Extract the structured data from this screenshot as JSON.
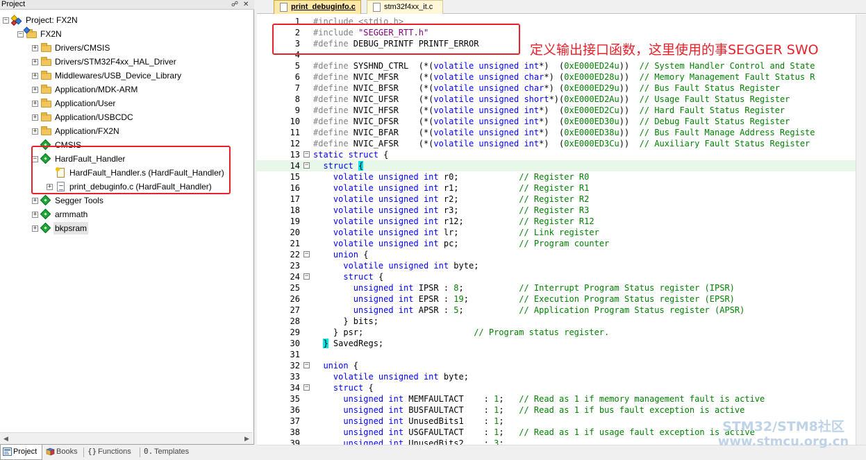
{
  "project_pane": {
    "title": "Project",
    "pin_icon": "pin-icon",
    "close_icon": "close-icon",
    "tree": [
      {
        "label": "Project: FX2N",
        "level": 0,
        "icon": "project-icon",
        "toggle": "−"
      },
      {
        "label": "FX2N",
        "level": 1,
        "icon": "target-folder-icon",
        "toggle": "−"
      },
      {
        "label": "Drivers/CMSIS",
        "level": 2,
        "icon": "folder-icon",
        "toggle": "+"
      },
      {
        "label": "Drivers/STM32F4xx_HAL_Driver",
        "level": 2,
        "icon": "folder-icon",
        "toggle": "+"
      },
      {
        "label": "Middlewares/USB_Device_Library",
        "level": 2,
        "icon": "folder-icon",
        "toggle": "+"
      },
      {
        "label": "Application/MDK-ARM",
        "level": 2,
        "icon": "folder-icon",
        "toggle": "+"
      },
      {
        "label": "Application/User",
        "level": 2,
        "icon": "folder-icon",
        "toggle": "+"
      },
      {
        "label": "Application/USBCDC",
        "level": 2,
        "icon": "folder-icon",
        "toggle": "+"
      },
      {
        "label": "Application/FX2N",
        "level": 2,
        "icon": "folder-icon",
        "toggle": "+"
      },
      {
        "label": "CMSIS",
        "level": 2,
        "icon": "diamond-icon",
        "toggle": ""
      },
      {
        "label": "HardFault_Handler",
        "level": 2,
        "icon": "diamond-icon",
        "toggle": "−"
      },
      {
        "label": "HardFault_Handler.s (HardFault_Handler)",
        "level": 3,
        "icon": "asm-file-icon",
        "toggle": ""
      },
      {
        "label": "print_debuginfo.c (HardFault_Handler)",
        "level": 3,
        "icon": "c-file-icon",
        "toggle": "+"
      },
      {
        "label": "Segger Tools",
        "level": 2,
        "icon": "diamond-icon",
        "toggle": "+"
      },
      {
        "label": "armmath",
        "level": 2,
        "icon": "diamond-icon",
        "toggle": "+"
      },
      {
        "label": "bkpsram",
        "level": 2,
        "icon": "diamond-icon",
        "toggle": "+",
        "selected": true
      }
    ],
    "bottom_tabs": [
      {
        "label": "Project",
        "icon": "project-tab-icon",
        "active": true
      },
      {
        "label": "Books",
        "icon": "books-icon",
        "active": false
      },
      {
        "label": "Functions",
        "icon": "functions-icon",
        "active": false
      },
      {
        "label": "Templates",
        "icon": "templates-icon",
        "active": false
      }
    ]
  },
  "editor": {
    "tabs": [
      {
        "label": "print_debuginfo.c",
        "active": true
      },
      {
        "label": "stm32f4xx_it.c",
        "active": false
      }
    ],
    "highlight_line": 14,
    "lines": [
      {
        "n": "1",
        "fold": "",
        "spans": [
          [
            "pp",
            "#include <stdio.h>"
          ]
        ]
      },
      {
        "n": "2",
        "fold": "",
        "spans": [
          [
            "pp",
            "#include "
          ],
          [
            "st",
            "\"SEGGER_RTT.h\""
          ]
        ]
      },
      {
        "n": "3",
        "fold": "",
        "spans": [
          [
            "pp",
            "#define"
          ],
          [
            "",
            " DEBUG_PRINTF PRINTF_ERROR"
          ]
        ]
      },
      {
        "n": "4",
        "fold": "",
        "spans": []
      },
      {
        "n": "5",
        "fold": "",
        "spans": [
          [
            "pp",
            "#define"
          ],
          [
            "",
            " SYSHND_CTRL  (*("
          ],
          [
            "kw",
            "volatile unsigned int"
          ],
          [
            "",
            "*)  ("
          ],
          [
            "nm",
            "0xE000ED24u"
          ],
          [
            "",
            "))  "
          ],
          [
            "cm",
            "// System Handler Control and State"
          ]
        ]
      },
      {
        "n": "6",
        "fold": "",
        "spans": [
          [
            "pp",
            "#define"
          ],
          [
            "",
            " NVIC_MFSR    (*("
          ],
          [
            "kw",
            "volatile unsigned char"
          ],
          [
            "",
            "*) ("
          ],
          [
            "nm",
            "0xE000ED28u"
          ],
          [
            "",
            "))  "
          ],
          [
            "cm",
            "// Memory Management Fault Status R"
          ]
        ]
      },
      {
        "n": "7",
        "fold": "",
        "spans": [
          [
            "pp",
            "#define"
          ],
          [
            "",
            " NVIC_BFSR    (*("
          ],
          [
            "kw",
            "volatile unsigned char"
          ],
          [
            "",
            "*) ("
          ],
          [
            "nm",
            "0xE000ED29u"
          ],
          [
            "",
            "))  "
          ],
          [
            "cm",
            "// Bus Fault Status Register"
          ]
        ]
      },
      {
        "n": "8",
        "fold": "",
        "spans": [
          [
            "pp",
            "#define"
          ],
          [
            "",
            " NVIC_UFSR    (*("
          ],
          [
            "kw",
            "volatile unsigned short"
          ],
          [
            "",
            "*)("
          ],
          [
            "nm",
            "0xE000ED2Au"
          ],
          [
            "",
            "))  "
          ],
          [
            "cm",
            "// Usage Fault Status Register"
          ]
        ]
      },
      {
        "n": "9",
        "fold": "",
        "spans": [
          [
            "pp",
            "#define"
          ],
          [
            "",
            " NVIC_HFSR    (*("
          ],
          [
            "kw",
            "volatile unsigned int"
          ],
          [
            "",
            "*)  ("
          ],
          [
            "nm",
            "0xE000ED2Cu"
          ],
          [
            "",
            "))  "
          ],
          [
            "cm",
            "// Hard Fault Status Register"
          ]
        ]
      },
      {
        "n": "10",
        "fold": "",
        "spans": [
          [
            "pp",
            "#define"
          ],
          [
            "",
            " NVIC_DFSR    (*("
          ],
          [
            "kw",
            "volatile unsigned int"
          ],
          [
            "",
            "*)  ("
          ],
          [
            "nm",
            "0xE000ED30u"
          ],
          [
            "",
            "))  "
          ],
          [
            "cm",
            "// Debug Fault Status Register"
          ]
        ]
      },
      {
        "n": "11",
        "fold": "",
        "spans": [
          [
            "pp",
            "#define"
          ],
          [
            "",
            " NVIC_BFAR    (*("
          ],
          [
            "kw",
            "volatile unsigned int"
          ],
          [
            "",
            "*)  ("
          ],
          [
            "nm",
            "0xE000ED38u"
          ],
          [
            "",
            "))  "
          ],
          [
            "cm",
            "// Bus Fault Manage Address Registe"
          ]
        ]
      },
      {
        "n": "12",
        "fold": "",
        "spans": [
          [
            "pp",
            "#define"
          ],
          [
            "",
            " NVIC_AFSR    (*("
          ],
          [
            "kw",
            "volatile unsigned int"
          ],
          [
            "",
            "*)  ("
          ],
          [
            "nm",
            "0xE000ED3Cu"
          ],
          [
            "",
            "))  "
          ],
          [
            "cm",
            "// Auxiliary Fault Status Register"
          ]
        ]
      },
      {
        "n": "13",
        "fold": "−",
        "spans": [
          [
            "kw",
            "static struct"
          ],
          [
            "",
            " {"
          ]
        ]
      },
      {
        "n": "14",
        "fold": "−",
        "spans": [
          [
            "",
            "  "
          ],
          [
            "kw",
            "struct"
          ],
          [
            "",
            " "
          ],
          [
            "br",
            "{"
          ]
        ]
      },
      {
        "n": "15",
        "fold": "",
        "spans": [
          [
            "",
            "    "
          ],
          [
            "kw",
            "volatile unsigned int"
          ],
          [
            "",
            " r0;            "
          ],
          [
            "cm",
            "// Register R0"
          ]
        ]
      },
      {
        "n": "16",
        "fold": "",
        "spans": [
          [
            "",
            "    "
          ],
          [
            "kw",
            "volatile unsigned int"
          ],
          [
            "",
            " r1;            "
          ],
          [
            "cm",
            "// Register R1"
          ]
        ]
      },
      {
        "n": "17",
        "fold": "",
        "spans": [
          [
            "",
            "    "
          ],
          [
            "kw",
            "volatile unsigned int"
          ],
          [
            "",
            " r2;            "
          ],
          [
            "cm",
            "// Register R2"
          ]
        ]
      },
      {
        "n": "18",
        "fold": "",
        "spans": [
          [
            "",
            "    "
          ],
          [
            "kw",
            "volatile unsigned int"
          ],
          [
            "",
            " r3;            "
          ],
          [
            "cm",
            "// Register R3"
          ]
        ]
      },
      {
        "n": "19",
        "fold": "",
        "spans": [
          [
            "",
            "    "
          ],
          [
            "kw",
            "volatile unsigned int"
          ],
          [
            "",
            " r12;           "
          ],
          [
            "cm",
            "// Register R12"
          ]
        ]
      },
      {
        "n": "20",
        "fold": "",
        "spans": [
          [
            "",
            "    "
          ],
          [
            "kw",
            "volatile unsigned int"
          ],
          [
            "",
            " lr;            "
          ],
          [
            "cm",
            "// Link register"
          ]
        ]
      },
      {
        "n": "21",
        "fold": "",
        "spans": [
          [
            "",
            "    "
          ],
          [
            "kw",
            "volatile unsigned int"
          ],
          [
            "",
            " pc;            "
          ],
          [
            "cm",
            "// Program counter"
          ]
        ]
      },
      {
        "n": "22",
        "fold": "−",
        "spans": [
          [
            "",
            "    "
          ],
          [
            "kw",
            "union"
          ],
          [
            "",
            " {"
          ]
        ]
      },
      {
        "n": "23",
        "fold": "",
        "spans": [
          [
            "",
            "      "
          ],
          [
            "kw",
            "volatile unsigned int"
          ],
          [
            "",
            " byte;"
          ]
        ]
      },
      {
        "n": "24",
        "fold": "−",
        "spans": [
          [
            "",
            "      "
          ],
          [
            "kw",
            "struct"
          ],
          [
            "",
            " {"
          ]
        ]
      },
      {
        "n": "25",
        "fold": "",
        "spans": [
          [
            "",
            "        "
          ],
          [
            "kw",
            "unsigned int"
          ],
          [
            "",
            " IPSR : "
          ],
          [
            "nm",
            "8"
          ],
          [
            "",
            ";           "
          ],
          [
            "cm",
            "// Interrupt Program Status register (IPSR)"
          ]
        ]
      },
      {
        "n": "26",
        "fold": "",
        "spans": [
          [
            "",
            "        "
          ],
          [
            "kw",
            "unsigned int"
          ],
          [
            "",
            " EPSR : "
          ],
          [
            "nm",
            "19"
          ],
          [
            "",
            ";          "
          ],
          [
            "cm",
            "// Execution Program Status register (EPSR)"
          ]
        ]
      },
      {
        "n": "27",
        "fold": "",
        "spans": [
          [
            "",
            "        "
          ],
          [
            "kw",
            "unsigned int"
          ],
          [
            "",
            " APSR : "
          ],
          [
            "nm",
            "5"
          ],
          [
            "",
            ";           "
          ],
          [
            "cm",
            "// Application Program Status register (APSR)"
          ]
        ]
      },
      {
        "n": "28",
        "fold": "",
        "spans": [
          [
            "",
            "      } bits;"
          ]
        ]
      },
      {
        "n": "29",
        "fold": "",
        "spans": [
          [
            "",
            "    } psr;                      "
          ],
          [
            "cm",
            "// Program status register."
          ]
        ]
      },
      {
        "n": "30",
        "fold": "",
        "spans": [
          [
            "",
            "  "
          ],
          [
            "br",
            "}"
          ],
          [
            "",
            " SavedRegs;"
          ]
        ]
      },
      {
        "n": "31",
        "fold": "",
        "spans": []
      },
      {
        "n": "32",
        "fold": "−",
        "spans": [
          [
            "",
            "  "
          ],
          [
            "kw",
            "union"
          ],
          [
            "",
            " {"
          ]
        ]
      },
      {
        "n": "33",
        "fold": "",
        "spans": [
          [
            "",
            "    "
          ],
          [
            "kw",
            "volatile unsigned int"
          ],
          [
            "",
            " byte;"
          ]
        ]
      },
      {
        "n": "34",
        "fold": "−",
        "spans": [
          [
            "",
            "    "
          ],
          [
            "kw",
            "struct"
          ],
          [
            "",
            " {"
          ]
        ]
      },
      {
        "n": "35",
        "fold": "",
        "spans": [
          [
            "",
            "      "
          ],
          [
            "kw",
            "unsigned int"
          ],
          [
            "",
            " MEMFAULTACT    : "
          ],
          [
            "nm",
            "1"
          ],
          [
            "",
            ";   "
          ],
          [
            "cm",
            "// Read as 1 if memory management fault is active"
          ]
        ]
      },
      {
        "n": "36",
        "fold": "",
        "spans": [
          [
            "",
            "      "
          ],
          [
            "kw",
            "unsigned int"
          ],
          [
            "",
            " BUSFAULTACT    : "
          ],
          [
            "nm",
            "1"
          ],
          [
            "",
            ";   "
          ],
          [
            "cm",
            "// Read as 1 if bus fault exception is active"
          ]
        ]
      },
      {
        "n": "37",
        "fold": "",
        "spans": [
          [
            "",
            "      "
          ],
          [
            "kw",
            "unsigned int"
          ],
          [
            "",
            " UnusedBits1    : "
          ],
          [
            "nm",
            "1"
          ],
          [
            "",
            ";"
          ]
        ]
      },
      {
        "n": "38",
        "fold": "",
        "spans": [
          [
            "",
            "      "
          ],
          [
            "kw",
            "unsigned int"
          ],
          [
            "",
            " USGFAULTACT    : "
          ],
          [
            "nm",
            "1"
          ],
          [
            "",
            ";   "
          ],
          [
            "cm",
            "// Read as 1 if usage fault exception is active"
          ]
        ]
      },
      {
        "n": "39",
        "fold": "",
        "spans": [
          [
            "",
            "      "
          ],
          [
            "kw",
            "unsigned int"
          ],
          [
            "",
            " UnusedBits2    : "
          ],
          [
            "nm",
            "3"
          ],
          [
            "",
            ";"
          ]
        ]
      }
    ]
  },
  "annotation": {
    "text": "定义输出接口函数，这里使用的事SEGGER SWO",
    "color": "#e8202a"
  },
  "watermark": {
    "line1": "STM32/STM8社区",
    "line2": "www.stmcu.org.cn"
  }
}
